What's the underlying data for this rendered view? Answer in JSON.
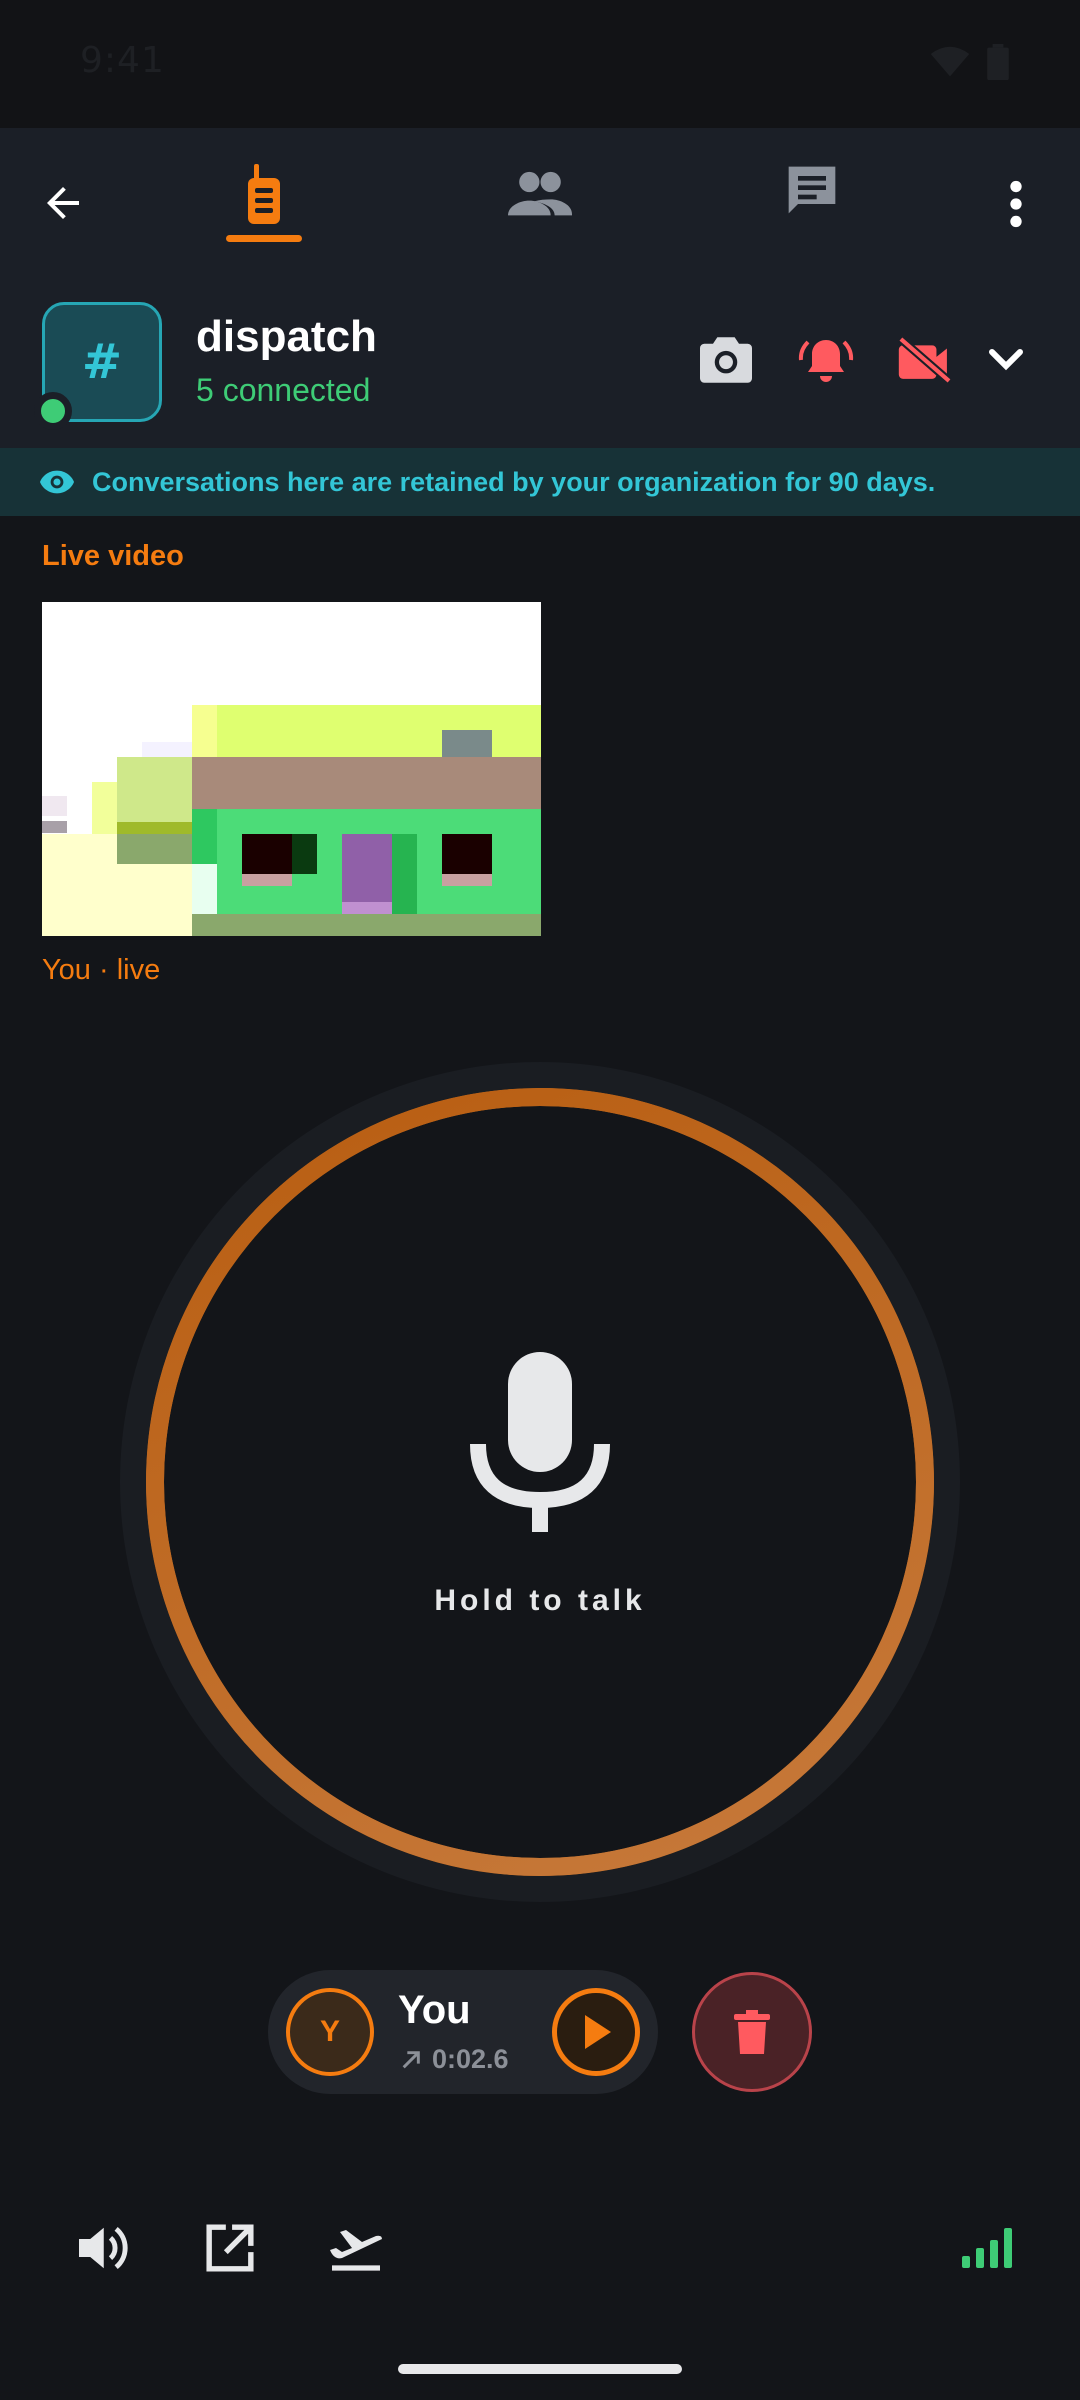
{
  "status_bar": {
    "time": "9:41"
  },
  "nav": {
    "back_icon": "arrow-left-icon",
    "tabs": [
      {
        "id": "walkie",
        "icon": "walkie-talkie-icon",
        "active": true
      },
      {
        "id": "members",
        "icon": "people-icon",
        "active": false
      },
      {
        "id": "chat",
        "icon": "chat-icon",
        "active": false
      }
    ],
    "more_icon": "more-vert-icon"
  },
  "channel": {
    "avatar_glyph": "#",
    "name": "dispatch",
    "connected_text": "5 connected",
    "online": true
  },
  "retention_notice": "Conversations here are retained by your organization for 90 days.",
  "live_video": {
    "section_label": "Live video",
    "caption": "You · live"
  },
  "ptt": {
    "label": "Hold to talk"
  },
  "clip": {
    "avatar_initial": "Y",
    "name": "You",
    "duration": "0:02.6"
  },
  "colors": {
    "accent": "#f57c10",
    "teal": "#33c6d6",
    "green": "#3ecc76",
    "danger": "#ff5a5f",
    "background": "#131519",
    "panel": "#1b1f27"
  }
}
